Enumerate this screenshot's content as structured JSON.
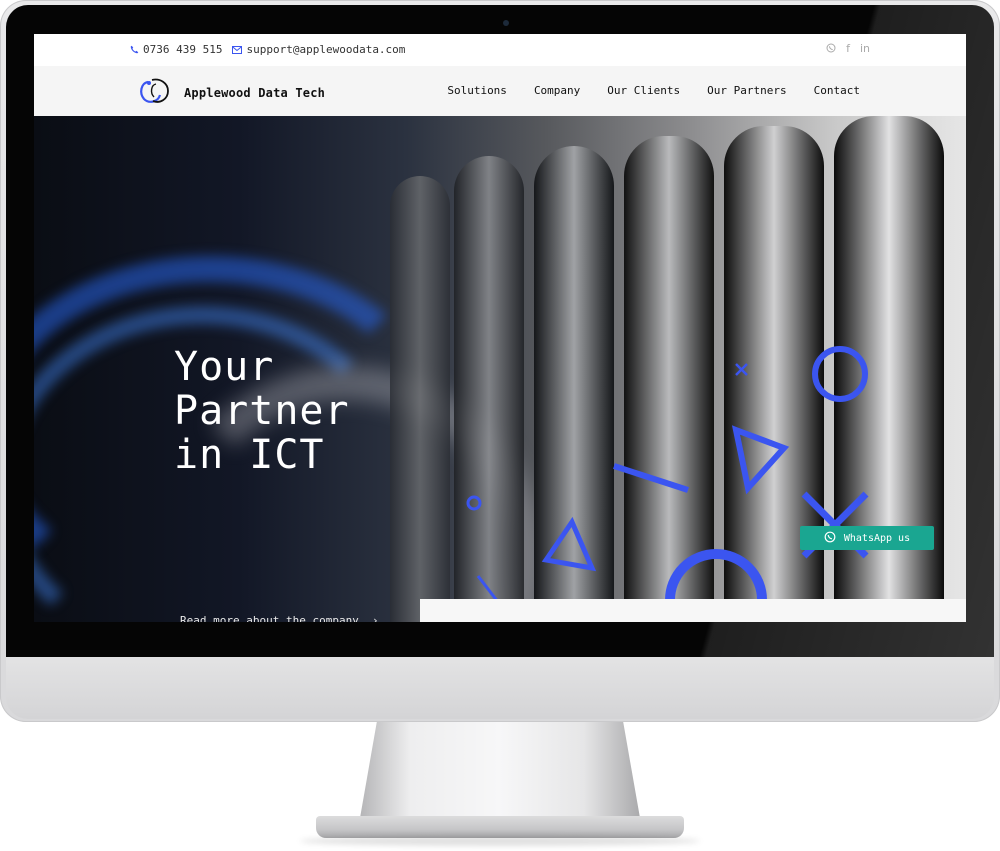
{
  "topbar": {
    "phone": "0736 439 515",
    "email": "support@applewoodata.com",
    "social_icons": [
      "whatsapp-icon",
      "facebook-icon",
      "linkedin-icon"
    ]
  },
  "header": {
    "brand": "Applewood Data Tech",
    "nav": [
      "Solutions",
      "Company",
      "Our Clients",
      "Our Partners",
      "Contact"
    ]
  },
  "hero": {
    "title": "Your\nPartner\nin ICT",
    "read_more": "Read more about the company"
  },
  "whatsapp_button": {
    "label": "WhatsApp us"
  },
  "colors": {
    "accent": "#3b55f0",
    "whatsapp": "#1aa691"
  }
}
